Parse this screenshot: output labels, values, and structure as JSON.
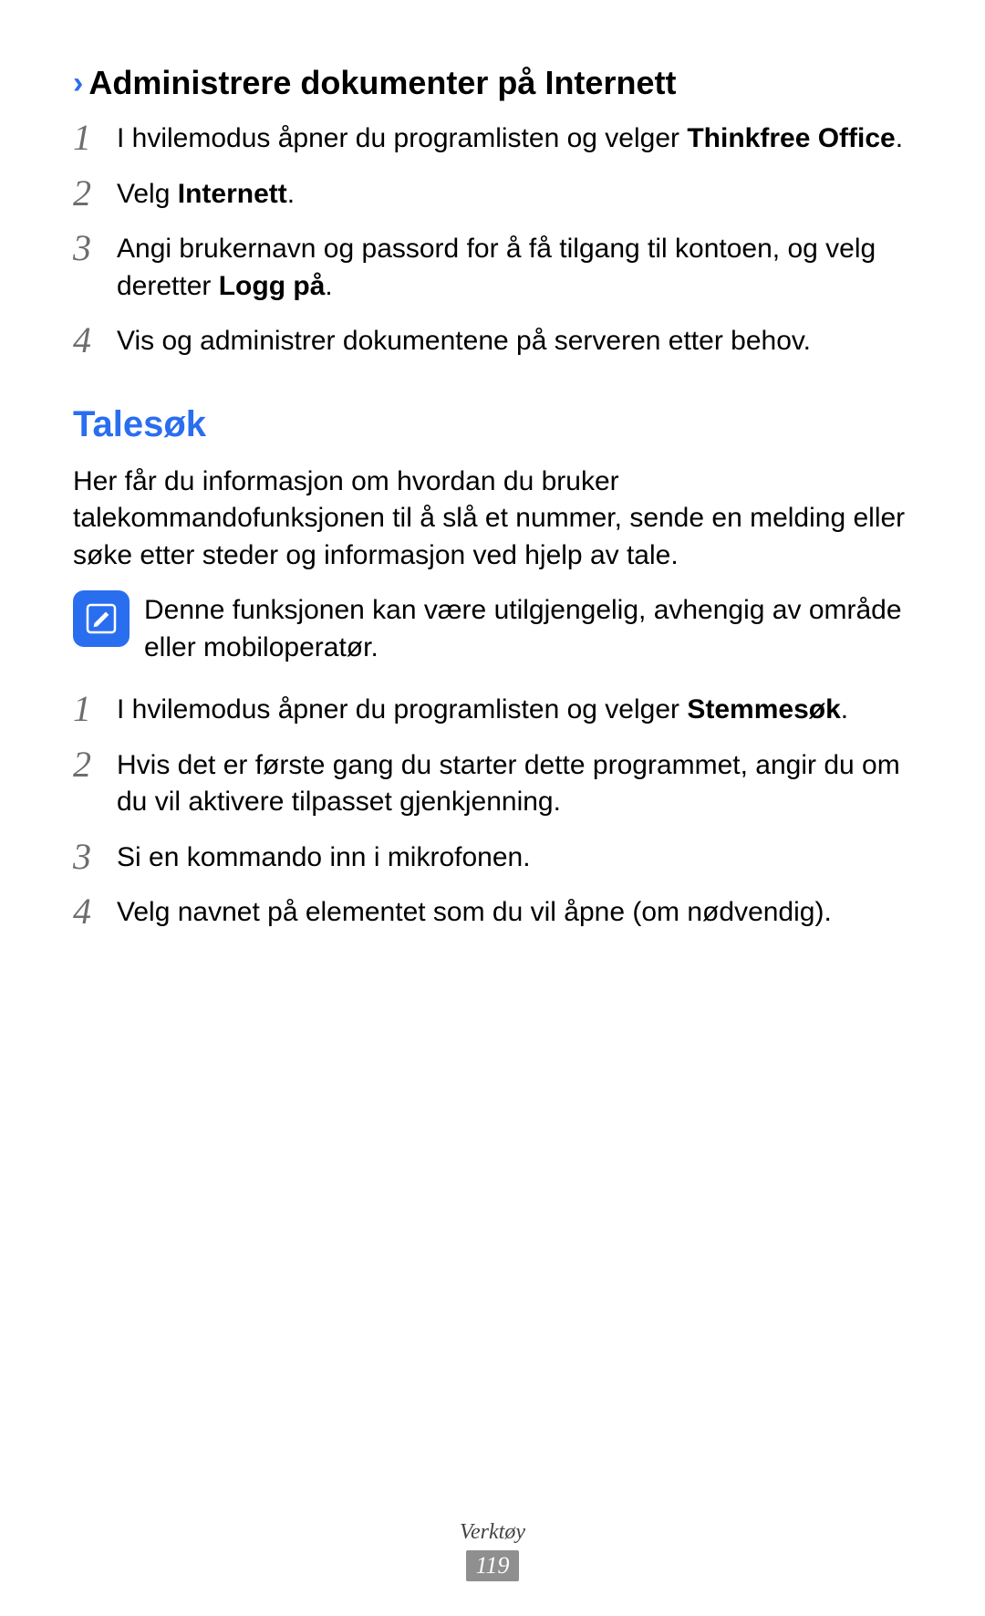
{
  "section1": {
    "chevron": "›",
    "title": "Administrere dokumenter på Internett",
    "steps": [
      {
        "num": "1",
        "body": "I hvilemodus åpner du programlisten og velger <b>Thinkfree Office</b>."
      },
      {
        "num": "2",
        "body": "Velg <b>Internett</b>."
      },
      {
        "num": "3",
        "body": "Angi brukernavn og passord for å få tilgang til kontoen, og velg deretter <b>Logg på</b>."
      },
      {
        "num": "4",
        "body": "Vis og administrer dokumentene på serveren etter behov."
      }
    ]
  },
  "section2": {
    "title": "Talesøk",
    "intro": "Her får du informasjon om hvordan du bruker talekommandofunksjonen til å slå et nummer, sende en melding eller søke etter steder og informasjon ved hjelp av tale.",
    "note": "Denne funksjonen kan være utilgjengelig, avhengig av område eller mobiloperatør.",
    "steps": [
      {
        "num": "1",
        "body": "I hvilemodus åpner du programlisten og velger <b>Stemmesøk</b>."
      },
      {
        "num": "2",
        "body": "Hvis det er første gang du starter dette programmet, angir du om du vil aktivere tilpasset gjenkjenning."
      },
      {
        "num": "3",
        "body": "Si en kommando inn i mikrofonen."
      },
      {
        "num": "4",
        "body": "Velg navnet på elementet som du vil åpne (om nødvendig)."
      }
    ]
  },
  "footer": {
    "section": "Verktøy",
    "page": "119"
  }
}
